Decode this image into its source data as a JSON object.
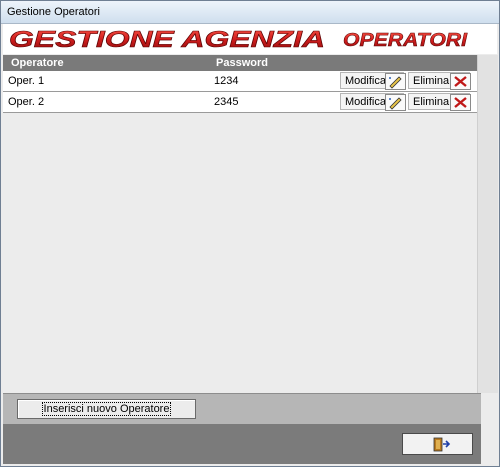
{
  "window": {
    "title": "Gestione Operatori"
  },
  "banner": {
    "title": "GESTIONE AGENZIA",
    "subtitle": "OPERATORI"
  },
  "table": {
    "columns": [
      "Operatore",
      "Password"
    ],
    "rows": [
      {
        "operatore": "Oper. 1",
        "password": "1234",
        "edit_label": "Modifica",
        "delete_label": "Elimina"
      },
      {
        "operatore": "Oper. 2",
        "password": "2345",
        "edit_label": "Modifica",
        "delete_label": "Elimina"
      }
    ]
  },
  "actions": {
    "add_label": "Inserisci nuovo Operatore"
  },
  "colors": {
    "banner_red": "#d21f1f",
    "header_gray": "#7a7a7a",
    "footer_gray": "#7b7b7b"
  },
  "icons": {
    "edit": "pencil-edit-icon",
    "delete": "red-x-delete-icon",
    "exit": "door-exit-icon"
  }
}
